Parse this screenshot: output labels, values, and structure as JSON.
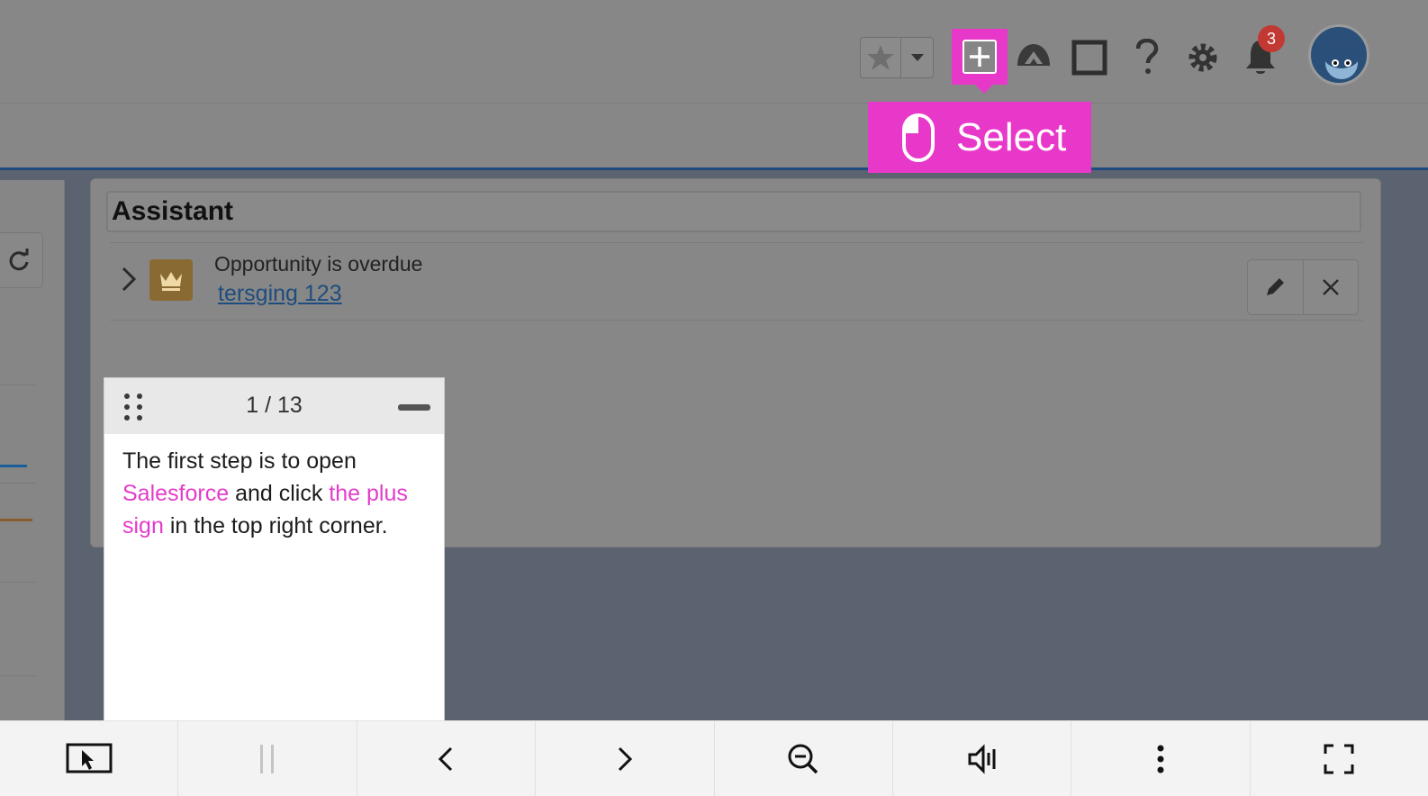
{
  "salesforce": {
    "toolbar": {
      "favorites_icon": "star-icon",
      "favorites_menu_icon": "chevron-down-icon",
      "global_actions_icon": "plus-icon",
      "trailhead_icon": "trailhead-icon",
      "setup_assistant_icon": "square-icon",
      "help_icon": "question-icon",
      "setup_icon": "gear-icon",
      "notifications_icon": "bell-icon",
      "notifications_count": "3",
      "avatar_icon": "astro-avatar-icon"
    },
    "assistant": {
      "title": "Assistant",
      "item": {
        "title": "Opportunity is overdue",
        "link": "tersging 123"
      }
    }
  },
  "callout": {
    "icon": "mouse-icon",
    "label": "Select"
  },
  "guide": {
    "step_counter": "1 / 13",
    "text_1": "The first step is to open ",
    "text_hl_1": "Salesforce",
    "text_2": " and click ",
    "text_hl_2": "the plus sign",
    "text_3": " in the top right corner."
  },
  "player": {
    "buttons": [
      "screen-pointer-icon",
      "pause-icon",
      "previous-icon",
      "next-icon",
      "zoom-out-icon",
      "volume-icon",
      "more-icon",
      "fullscreen-icon"
    ]
  },
  "colors": {
    "highlight": "#e838c9",
    "badge": "#c23934",
    "guide_highlight_text": "#e33cc8"
  }
}
